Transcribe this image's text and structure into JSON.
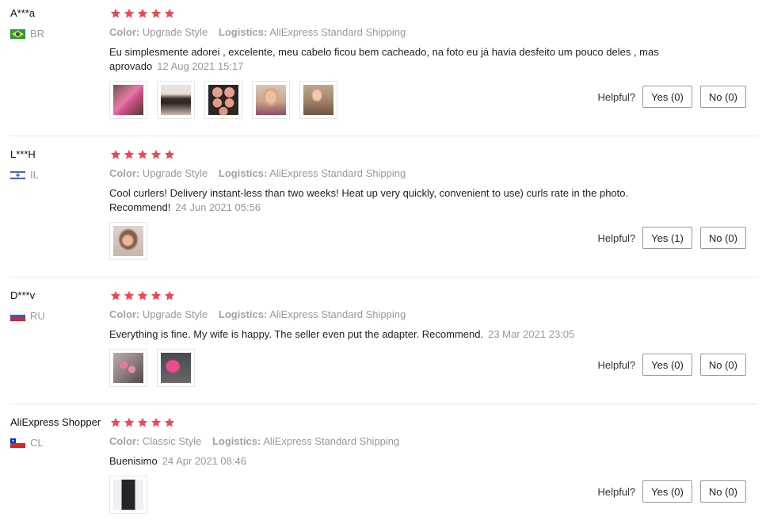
{
  "reviews": [
    {
      "user": "A***a",
      "country": "BR",
      "rating": 5,
      "color_label": "Color:",
      "color_value": "Upgrade Style",
      "logistics_label": "Logistics:",
      "logistics_value": "AliExpress Standard Shipping",
      "text": "Eu simplesmente adorei , excelente, meu cabelo ficou bem cacheado, na foto eu já havia desfeito um pouco deles , mas aprovado",
      "date": "12 Aug 2021 15:17",
      "photos": 5,
      "helpful_label": "Helpful?",
      "yes": "Yes (0)",
      "no": "No (0)"
    },
    {
      "user": "L***H",
      "country": "IL",
      "rating": 5,
      "color_label": "Color:",
      "color_value": "Upgrade Style",
      "logistics_label": "Logistics:",
      "logistics_value": "AliExpress Standard Shipping",
      "text": "Cool curlers! Delivery instant-less than two weeks! Heat up very quickly, convenient to use) curls rate in the photo. Recommend!",
      "date": "24 Jun 2021 05:56",
      "photos": 1,
      "helpful_label": "Helpful?",
      "yes": "Yes (1)",
      "no": "No (0)"
    },
    {
      "user": "D***v",
      "country": "RU",
      "rating": 5,
      "color_label": "Color:",
      "color_value": "Upgrade Style",
      "logistics_label": "Logistics:",
      "logistics_value": "AliExpress Standard Shipping",
      "text": "Everything is fine. My wife is happy. The seller even put the adapter. Recommend.",
      "date": "23 Mar 2021 23:05",
      "photos": 2,
      "helpful_label": "Helpful?",
      "yes": "Yes (0)",
      "no": "No (0)"
    },
    {
      "user": "AliExpress Shopper",
      "country": "CL",
      "rating": 5,
      "color_label": "Color:",
      "color_value": "Classic Style",
      "logistics_label": "Logistics:",
      "logistics_value": "AliExpress Standard Shipping",
      "text": "Buenisimo",
      "date": "24 Apr 2021 08:46",
      "photos": 1,
      "helpful_label": "Helpful?",
      "yes": "Yes (0)",
      "no": "No (0)"
    }
  ],
  "colors": {
    "star": "#f0474f",
    "muted": "#999999",
    "button_border": "#999999"
  }
}
